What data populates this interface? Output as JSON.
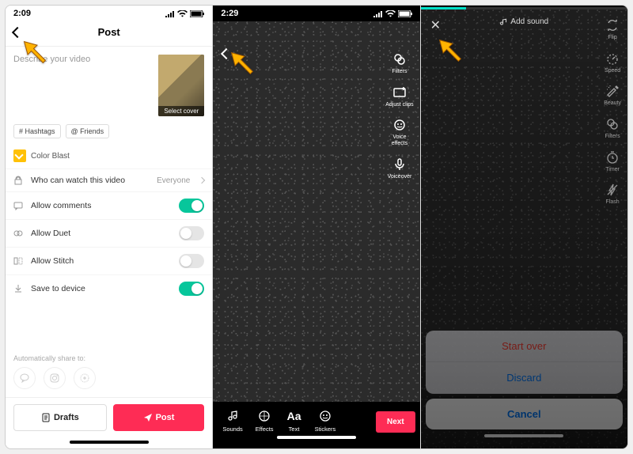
{
  "phone1": {
    "time": "2:09",
    "title": "Post",
    "describe_placeholder": "Describe your video",
    "select_cover": "Select cover",
    "chips": {
      "hashtags": "# Hashtags",
      "friends": "@ Friends"
    },
    "color_blast": "Color Blast",
    "rows": {
      "privacy": {
        "label": "Who can watch this video",
        "value": "Everyone"
      },
      "comments": {
        "label": "Allow comments"
      },
      "duet": {
        "label": "Allow Duet"
      },
      "stitch": {
        "label": "Allow Stitch"
      },
      "save": {
        "label": "Save to device"
      }
    },
    "auto_share": "Automatically share to:",
    "buttons": {
      "drafts": "Drafts",
      "post": "Post"
    }
  },
  "phone2": {
    "time": "2:29",
    "side_tools": {
      "filters": "Filters",
      "adjust": "Adjust clips",
      "voice_effects": "Voice\neffects",
      "voiceover": "Voiceover"
    },
    "bottom_tools": {
      "sounds": "Sounds",
      "effects": "Effects",
      "text": "Text",
      "stickers": "Stickers"
    },
    "next": "Next"
  },
  "phone3": {
    "add_sound": "Add sound",
    "side_tools": {
      "flip": "Flip",
      "speed": "Speed",
      "beauty": "Beauty",
      "filters": "Filters",
      "timer": "Timer",
      "flash": "Flash"
    },
    "sheet": {
      "start_over": "Start over",
      "discard": "Discard",
      "cancel": "Cancel"
    }
  }
}
